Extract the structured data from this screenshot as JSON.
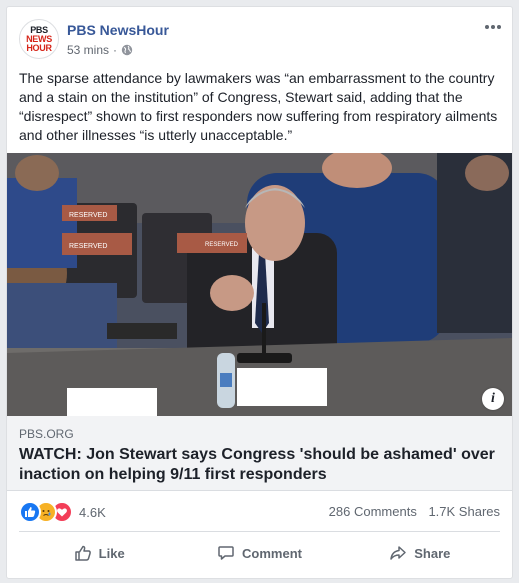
{
  "post": {
    "page_name": "PBS NewsHour",
    "avatar": {
      "line1": "PBS",
      "line2": "NEWS",
      "line3": "HOUR"
    },
    "timestamp": "53 mins",
    "separator": "·",
    "privacy_icon": "globe-icon",
    "more_icon": "more-options-icon",
    "text": "The sparse attendance by lawmakers was “an embarrassment to the country and a stain on the institution” of Congress, Stewart said, adding that the “disrespect” shown to first responders now suffering from respiratory ailments and other illnesses “is utterly unacceptable.”"
  },
  "link": {
    "domain": "PBS.ORG",
    "title": "WATCH: Jon Stewart says Congress 'should be ashamed' over inaction on helping 9/11 first responders",
    "info_label": "i"
  },
  "photo": {
    "placards": [
      "RESERVED",
      "RESERVED",
      "RESERVED"
    ]
  },
  "stats": {
    "reaction_icons": [
      "like-reaction-icon",
      "sad-reaction-icon",
      "love-reaction-icon"
    ],
    "reaction_count": "4.6K",
    "comments": "286 Comments",
    "shares": "1.7K Shares"
  },
  "actions": {
    "like": "Like",
    "comment": "Comment",
    "share": "Share"
  },
  "colors": {
    "link_blue": "#385898",
    "like_blue": "#1877f2",
    "love_red": "#f33e58",
    "sad_yellow": "#f7b125"
  }
}
